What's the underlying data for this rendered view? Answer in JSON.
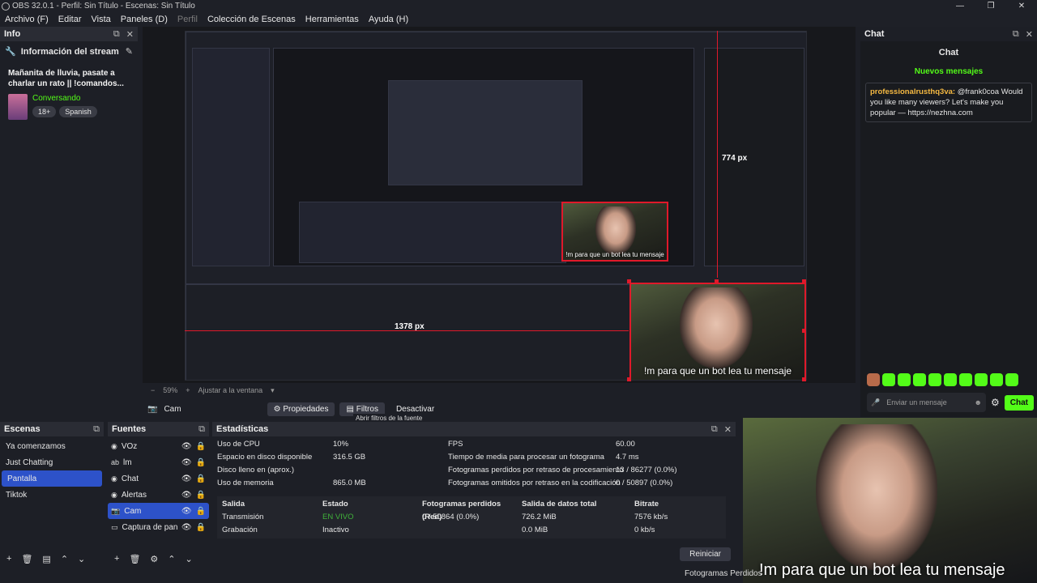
{
  "window": {
    "title": "OBS 32.0.1 - Perfil: Sin Título - Escenas: Sin Título"
  },
  "menu": {
    "file": "Archivo (F)",
    "edit": "Editar",
    "view": "Vista",
    "docks": "Paneles (D)",
    "profile": "Perfil",
    "scene_collection": "Colección de Escenas",
    "tools": "Herramientas",
    "help": "Ayuda (H)"
  },
  "info_dock": {
    "title": "Info",
    "section": "Información del stream",
    "stream_title": "Mañanita de lluvia, pasate a charlar un rato || !comandos...",
    "category": "Conversando",
    "tags": [
      "18+",
      "Spanish"
    ]
  },
  "chat_dock": {
    "title": "Chat",
    "heading": "Chat",
    "new_messages": "Nuevos mensajes",
    "message": {
      "user": "professionalrusthq3va:",
      "text": " @frank0coa Would you like many viewers? Let's make you popular — https://nezhna.com"
    },
    "input_placeholder": "Enviar un mensaje",
    "send_label": "Chat"
  },
  "preview": {
    "measure_v": "774 px",
    "measure_h": "1378 px",
    "caption": "!m para que un bot lea tu mensaje",
    "zoom": "59%",
    "fit": "Ajustar a la ventana"
  },
  "context_bar": {
    "source": "Cam",
    "properties": "Propiedades",
    "filters": "Filtros",
    "deactivate": "Desactivar",
    "tooltip": "Abrir filtros de la fuente"
  },
  "scenes": {
    "title": "Escenas",
    "items": [
      "Ya comenzamos",
      "Just Chatting",
      "Pantalla",
      "Tiktok"
    ],
    "selected": "Pantalla"
  },
  "sources": {
    "title": "Fuentes",
    "items": [
      "VOz",
      "lm",
      "Chat",
      "Alertas",
      "Cam",
      "Captura de pantalla"
    ],
    "selected": "Cam"
  },
  "stats": {
    "title": "Estadísticas",
    "cpu_label": "Uso de CPU",
    "cpu": "10%",
    "disk_label": "Espacio en disco disponible",
    "disk": "316.5 GB",
    "disk_full_label": "Disco lleno en (aprox.)",
    "disk_full": "",
    "mem_label": "Uso de memoria",
    "mem": "865.0 MB",
    "fps_label": "FPS",
    "fps": "60.00",
    "render_label": "Tiempo de media para procesar un fotograma",
    "render": "4.7 ms",
    "lag_label": "Fotogramas perdidos por retraso de procesamiento",
    "lag": "13 / 86277 (0.0%)",
    "skip_label": "Fotogramas omitidos por retraso en la codificación",
    "skip": "0 / 50897 (0.0%)",
    "table_headers": [
      "Salida",
      "Estado",
      "Fotogramas perdidos (Red)",
      "Salida de datos total",
      "Bitrate"
    ],
    "rows": [
      [
        "Transmisión",
        "EN VIVO",
        "0 / 50864 (0.0%)",
        "726.2 MiB",
        "7576 kb/s"
      ],
      [
        "Grabación",
        "Inactivo",
        "",
        "0.0 MiB",
        "0 kb/s"
      ]
    ],
    "reset": "Reiniciar"
  },
  "status": {
    "dropped": "Fotogramas Perdidos"
  },
  "webcam": {
    "caption": "!m para que un bot lea tu mensaje"
  }
}
